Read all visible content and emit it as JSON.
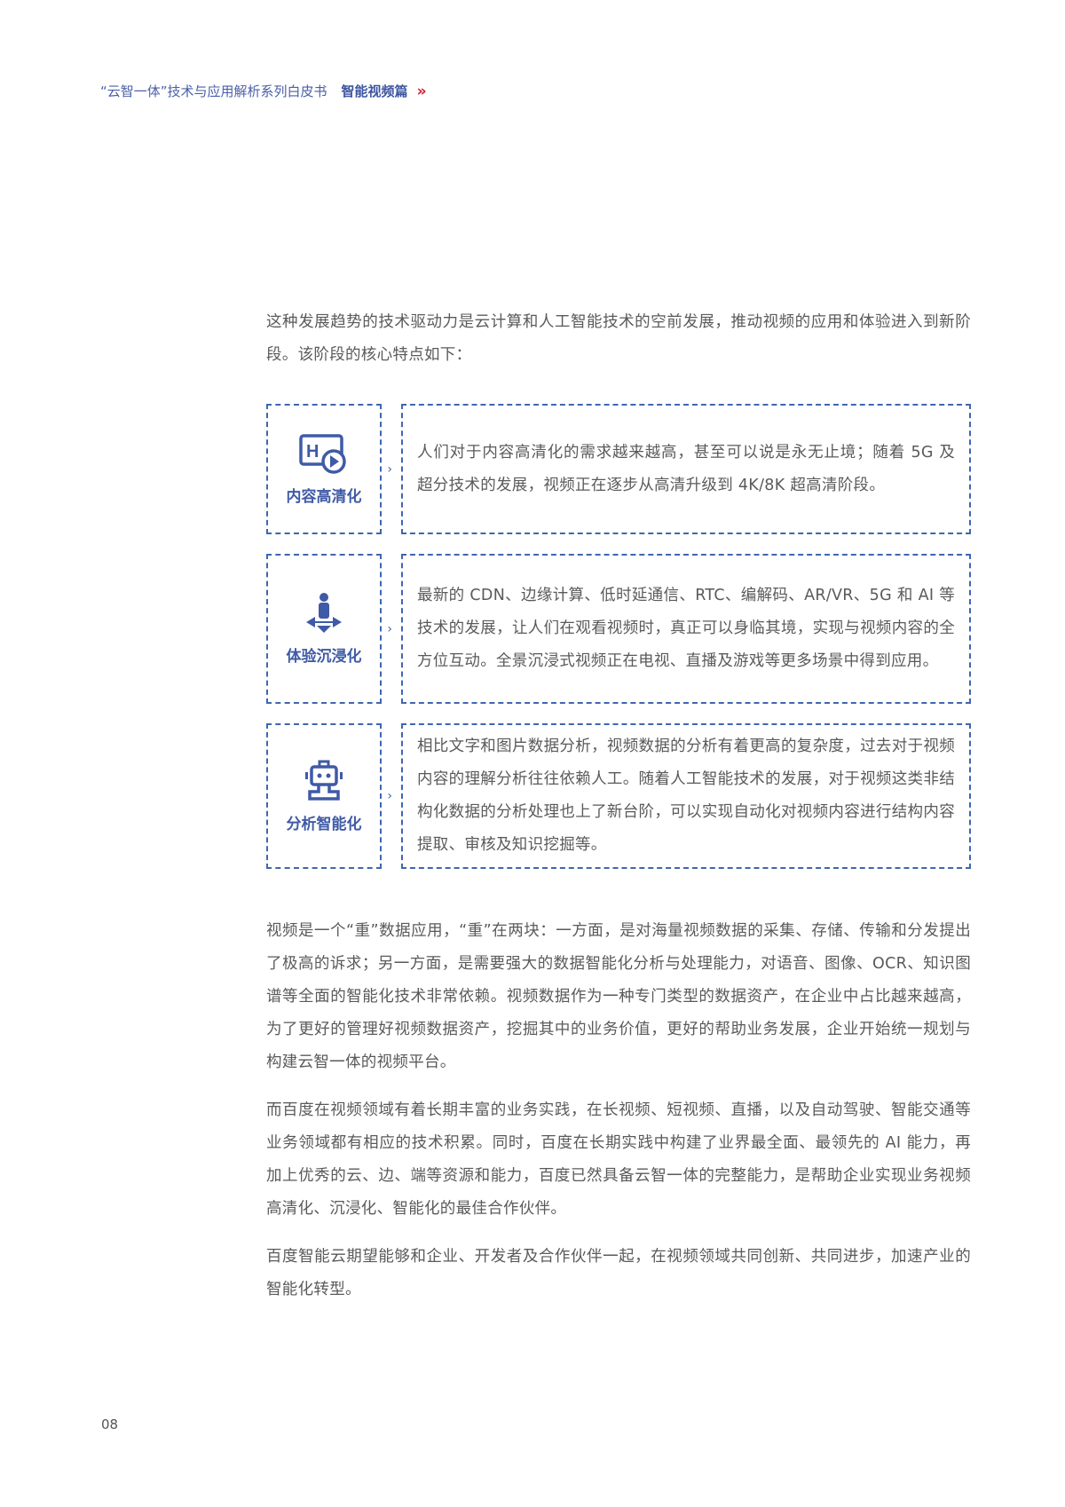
{
  "header": {
    "series": "“云智一体”技术与应用解析系列白皮书",
    "section": "智能视频篇",
    "chevron": "»"
  },
  "intro": "这种发展趋势的技术驱动力是云计算和人工智能技术的空前发展，推动视频的应用和体验进入到新阶段。该阶段的核心特点如下：",
  "features": [
    {
      "icon": "hd-video-icon",
      "label": "内容高清化",
      "text": "人们对于内容高清化的需求越来越高，甚至可以说是永无止境；随着 5G 及超分技术的发展，视频正在逐步从高清升级到 4K/8K 超高清阶段。"
    },
    {
      "icon": "immersive-person-icon",
      "label": "体验沉浸化",
      "text": "最新的 CDN、边缘计算、低时延通信、RTC、编解码、AR/VR、5G 和 AI 等技术的发展，让人们在观看视频时，真正可以身临其境，实现与视频内容的全方位互动。全景沉浸式视频正在电视、直播及游戏等更多场景中得到应用。"
    },
    {
      "icon": "robot-icon",
      "label": "分析智能化",
      "text": "相比文字和图片数据分析，视频数据的分析有着更高的复杂度，过去对于视频内容的理解分析往往依赖人工。随着人工智能技术的发展，对于视频这类非结构化数据的分析处理也上了新台阶，可以实现自动化对视频内容进行结构内容提取、审核及知识挖掘等。"
    }
  ],
  "paragraphs": [
    "视频是一个“重”数据应用，“重”在两块：一方面，是对海量视频数据的采集、存储、传输和分发提出了极高的诉求；另一方面，是需要强大的数据智能化分析与处理能力，对语音、图像、OCR、知识图谱等全面的智能化技术非常依赖。视频数据作为一种专门类型的数据资产，在企业中占比越来越高，为了更好的管理好视频数据资产，挖掘其中的业务价值，更好的帮助业务发展，企业开始统一规划与构建云智一体的视频平台。",
    "而百度在视频领域有着长期丰富的业务实践，在长视频、短视频、直播，以及自动驾驶、智能交通等业务领域都有相应的技术积累。同时，百度在长期实践中构建了业界最全面、最领先的 AI 能力，再加上优秀的云、边、端等资源和能力，百度已然具备云智一体的完整能力，是帮助企业实现业务视频高清化、沉浸化、智能化的最佳合作伙伴。",
    "百度智能云期望能够和企业、开发者及合作伙伴一起，在视频领域共同创新、共同进步，加速产业的智能化转型。"
  ],
  "page_number": "08"
}
